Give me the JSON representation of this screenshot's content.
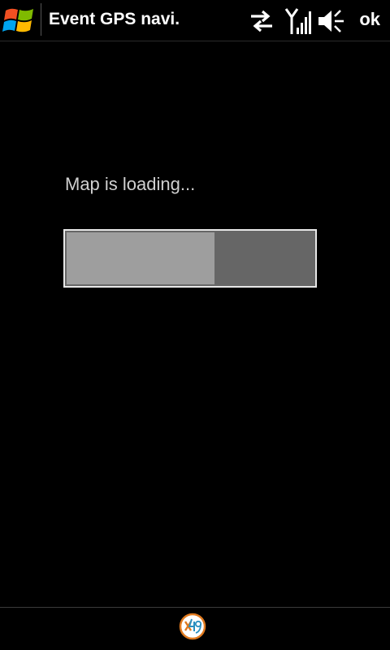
{
  "titlebar": {
    "app_title": "Event GPS navi.",
    "ok_label": "ok",
    "icons": [
      "windows-start-icon",
      "sync-arrows-icon",
      "signal-strength-icon",
      "speaker-muted-icon"
    ]
  },
  "main": {
    "loading_text": "Map is loading...",
    "progress": 0.6
  },
  "bottombar": {
    "logo_icon": "x49-logo-icon"
  },
  "colors": {
    "background": "#000000",
    "progress_fill": "#9e9e9e",
    "progress_track": "#666666",
    "logo_accent": "#e07a1f"
  }
}
